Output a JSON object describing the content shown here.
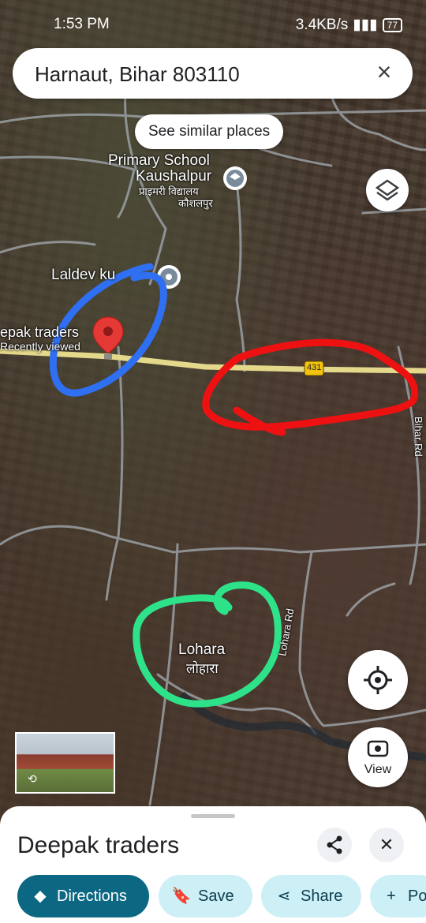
{
  "status_bar": {
    "time": "1:53 PM",
    "network_speed": "3.4KB/s",
    "battery": "77"
  },
  "search": {
    "query": "Harnaut, Bihar 803110",
    "clear_icon": "close-icon"
  },
  "similar_chip": {
    "label": "See similar places"
  },
  "map": {
    "labels": {
      "school_en": "Primary School",
      "school_en2": "Kaushalpur",
      "school_hi": "प्राइमरी विद्यालय",
      "school_hi2": "कौशलपुर",
      "laldev": "Laldev ku",
      "deepak": "epak traders",
      "recently": "Recently viewed",
      "road_badge": "431",
      "lohara_en": "Lohara",
      "lohara_hi": "लोहारा",
      "lohara_rd": "Lohara Rd",
      "side_rd": "Bihar Rd"
    },
    "annotation_colors": {
      "blue": "#2f6ff2",
      "red": "#ee1111",
      "green": "#2ee28a"
    }
  },
  "controls": {
    "layers_icon": "layers-icon",
    "locate_icon": "my-location-icon",
    "view_label": "View"
  },
  "place_sheet": {
    "name": "Deepak traders",
    "share_icon": "share-icon",
    "close_icon": "close-icon",
    "actions": [
      {
        "label": "Directions",
        "icon": "directions-icon"
      },
      {
        "label": "Save",
        "icon": "bookmark-icon"
      },
      {
        "label": "Share",
        "icon": "share-icon"
      },
      {
        "label": "Po",
        "icon": "plus-icon"
      }
    ]
  }
}
